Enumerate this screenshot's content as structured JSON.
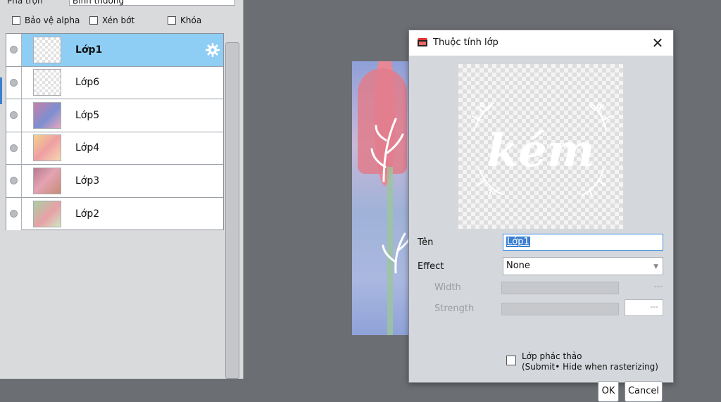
{
  "layers_panel": {
    "blend_label": "Pha trộn",
    "blend_value": "Bình thường",
    "options": [
      {
        "label": "Bảo vệ alpha"
      },
      {
        "label": "Xén bớt"
      },
      {
        "label": "Khóa"
      }
    ],
    "layers": [
      {
        "name": "Lớp1",
        "selected": true
      },
      {
        "name": "Lớp6"
      },
      {
        "name": "Lớp5"
      },
      {
        "name": "Lớp4"
      },
      {
        "name": "Lớp3"
      },
      {
        "name": "Lớp2"
      }
    ],
    "icons": {
      "settings": "gear-icon",
      "visibility": "eye-dot-icon"
    }
  },
  "dialog": {
    "title": "Thuộc tính lớp",
    "preview_text": "kém",
    "name_label": "Tên",
    "name_value": "Lớp1",
    "effect_label": "Effect",
    "effect_value": "None",
    "width_label": "Width",
    "width_value": "---",
    "strength_label": "Strength",
    "strength_value": "---",
    "sketch_line1": "Lớp phác thảo",
    "sketch_line2": "(Submit• Hide when rasterizing)",
    "ok_label": "OK",
    "cancel_label": "Cancel"
  },
  "colors": {
    "selected_row": "#8ecdf4",
    "focus_border": "#3a8ee6"
  }
}
